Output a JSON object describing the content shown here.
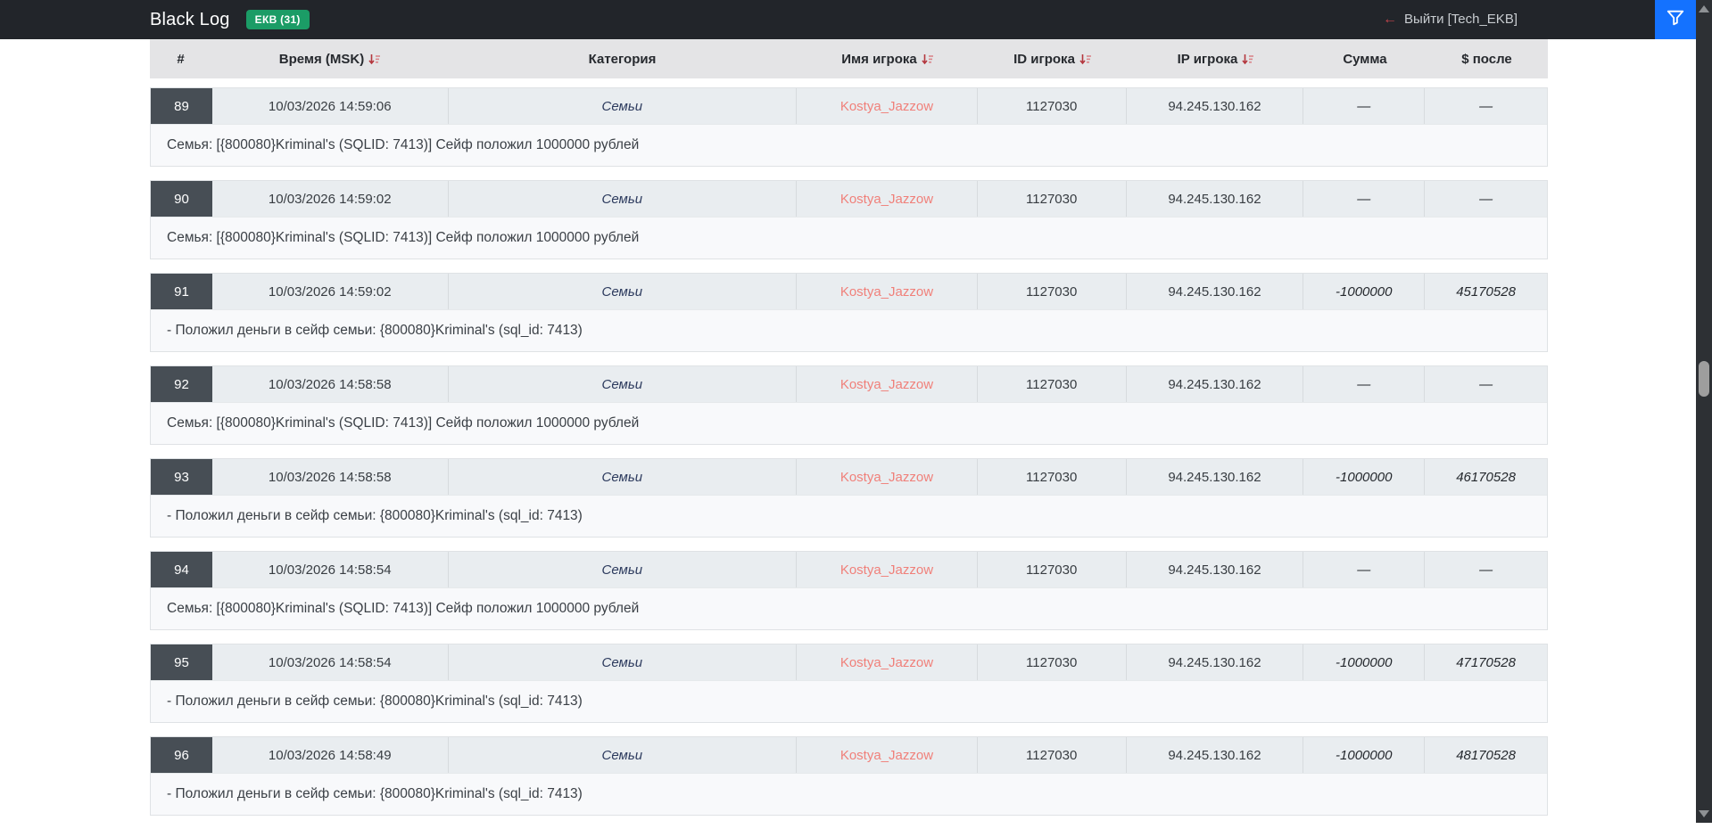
{
  "topbar": {
    "title": "Black Log",
    "badge": "ЕКВ (31)",
    "logout_arrow": "←",
    "logout_label": "Выйти [Tech_EKB]"
  },
  "icons": {
    "filter": "funnel-icon",
    "sort": "sort-descending-icon",
    "scroll_up": "triangle-up-icon",
    "scroll_down": "triangle-down-icon"
  },
  "colors": {
    "topbar_bg": "#22252a",
    "badge_green": "#1b9c66",
    "filter_blue": "#1472ff",
    "sort_red": "#b4373e",
    "player_pink": "#f0807a",
    "category_navy": "#2d3b5e",
    "row_bg": "#e9edf0",
    "num_cell_bg": "#474e55"
  },
  "table": {
    "columns": [
      {
        "label": "#",
        "sortable": false
      },
      {
        "label": "Время (MSK)",
        "sortable": true
      },
      {
        "label": "Категория",
        "sortable": false
      },
      {
        "label": "Имя игрока",
        "sortable": true
      },
      {
        "label": "ID игрока",
        "sortable": true
      },
      {
        "label": "IP игрока",
        "sortable": true
      },
      {
        "label": "Сумма",
        "sortable": false
      },
      {
        "label": "$ после",
        "sortable": false
      }
    ],
    "rows": [
      {
        "num": "89",
        "time": "10/03/2026 14:59:06",
        "category": "Семьи",
        "player": "Kostya_Jazzow",
        "player_id": "1127030",
        "ip": "94.245.130.162",
        "sum": "—",
        "after": "—",
        "message": "Семья: [{800080}Kriminal's (SQLID: 7413)] Сейф положил 1000000 рублей"
      },
      {
        "num": "90",
        "time": "10/03/2026 14:59:02",
        "category": "Семьи",
        "player": "Kostya_Jazzow",
        "player_id": "1127030",
        "ip": "94.245.130.162",
        "sum": "—",
        "after": "—",
        "message": "Семья: [{800080}Kriminal's (SQLID: 7413)] Сейф положил 1000000 рублей"
      },
      {
        "num": "91",
        "time": "10/03/2026 14:59:02",
        "category": "Семьи",
        "player": "Kostya_Jazzow",
        "player_id": "1127030",
        "ip": "94.245.130.162",
        "sum": "-1000000",
        "after": "45170528",
        "message": "- Положил деньги в сейф семьи: {800080}Kriminal's (sql_id: 7413)"
      },
      {
        "num": "92",
        "time": "10/03/2026 14:58:58",
        "category": "Семьи",
        "player": "Kostya_Jazzow",
        "player_id": "1127030",
        "ip": "94.245.130.162",
        "sum": "—",
        "after": "—",
        "message": "Семья: [{800080}Kriminal's (SQLID: 7413)] Сейф положил 1000000 рублей"
      },
      {
        "num": "93",
        "time": "10/03/2026 14:58:58",
        "category": "Семьи",
        "player": "Kostya_Jazzow",
        "player_id": "1127030",
        "ip": "94.245.130.162",
        "sum": "-1000000",
        "after": "46170528",
        "message": "- Положил деньги в сейф семьи: {800080}Kriminal's (sql_id: 7413)"
      },
      {
        "num": "94",
        "time": "10/03/2026 14:58:54",
        "category": "Семьи",
        "player": "Kostya_Jazzow",
        "player_id": "1127030",
        "ip": "94.245.130.162",
        "sum": "—",
        "after": "—",
        "message": "Семья: [{800080}Kriminal's (SQLID: 7413)] Сейф положил 1000000 рублей"
      },
      {
        "num": "95",
        "time": "10/03/2026 14:58:54",
        "category": "Семьи",
        "player": "Kostya_Jazzow",
        "player_id": "1127030",
        "ip": "94.245.130.162",
        "sum": "-1000000",
        "after": "47170528",
        "message": "- Положил деньги в сейф семьи: {800080}Kriminal's (sql_id: 7413)"
      },
      {
        "num": "96",
        "time": "10/03/2026 14:58:49",
        "category": "Семьи",
        "player": "Kostya_Jazzow",
        "player_id": "1127030",
        "ip": "94.245.130.162",
        "sum": "-1000000",
        "after": "48170528",
        "message": "- Положил деньги в сейф семьи: {800080}Kriminal's (sql_id: 7413)"
      }
    ]
  }
}
